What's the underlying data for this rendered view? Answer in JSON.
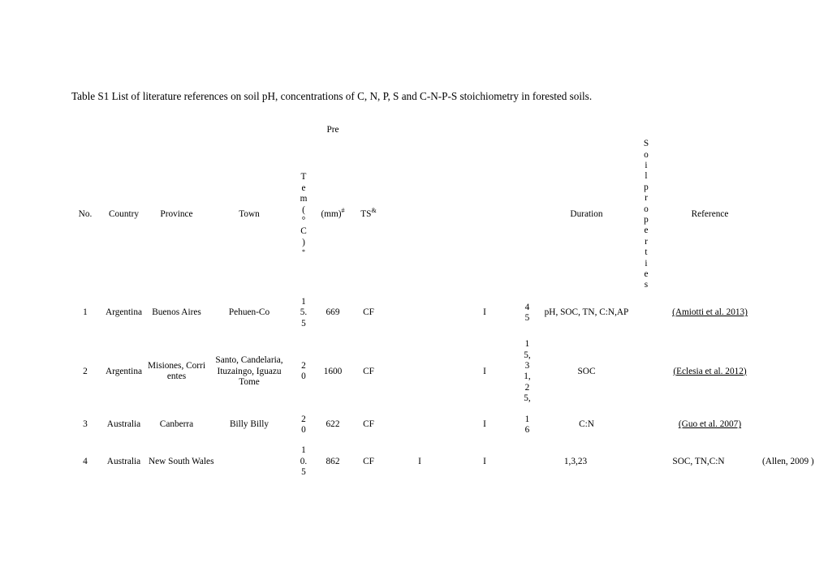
{
  "document": {
    "caption": "Table S1 List of literature references on soil pH, concentrations of C, N, P, S and C-N-P-S stoichiometry in forested soils."
  },
  "table": {
    "group_header": {
      "pre": "Pre"
    },
    "headers": {
      "no": "No.",
      "country": "Country",
      "province": "Province",
      "town": "Town",
      "temperature": "Tem(°C)",
      "temperature_mark": "*",
      "precipitation": "(mm)",
      "precipitation_mark": "#",
      "ts": "TS",
      "ts_mark": "&",
      "blank1": "",
      "duration": "Duration",
      "soil_properties": "Soil properties",
      "reference": "Reference"
    },
    "rows": [
      {
        "no": "1",
        "country": "Argentina",
        "province": "Buenos Aires",
        "town": "Pehuen-Co",
        "temperature": "15.5",
        "precipitation": "669",
        "ts": "CF",
        "blank1": "",
        "treatment": "I",
        "duration": "45",
        "soil_properties": "pH, SOC, TN, C:N,AP",
        "reference": "(Amiotti et al. 2013)",
        "reference_underlined": true
      },
      {
        "no": "2",
        "country": "Argentina",
        "province": "Misiones, Corrientes",
        "town": "Santo, Candelaria, Ituzaingo, Iguazu Tome",
        "temperature": "20",
        "precipitation": "1600",
        "ts": "CF",
        "blank1": "",
        "treatment": "I",
        "duration": "15,31,25,",
        "soil_properties": "SOC",
        "reference": "(Eclesia et al. 2012)",
        "reference_underlined": true
      },
      {
        "no": "3",
        "country": "Australia",
        "province": "Canberra",
        "town": "Billy Billy",
        "temperature": "20",
        "precipitation": "622",
        "ts": "CF",
        "blank1": "",
        "treatment": "I",
        "duration": "16",
        "soil_properties": "C:N",
        "reference": "(Guo et al. 2007)",
        "reference_underlined": true
      },
      {
        "no": "4",
        "country": "Australia",
        "province": "New South Wales",
        "town": "",
        "temperature": "10.5",
        "precipitation": "862",
        "ts": "CF",
        "blank1": "I",
        "treatment": "I",
        "duration": "1,3,23",
        "soil_properties": "SOC, TN,C:N",
        "reference": "(Allen, 2009 )",
        "reference_underlined": false
      }
    ]
  }
}
